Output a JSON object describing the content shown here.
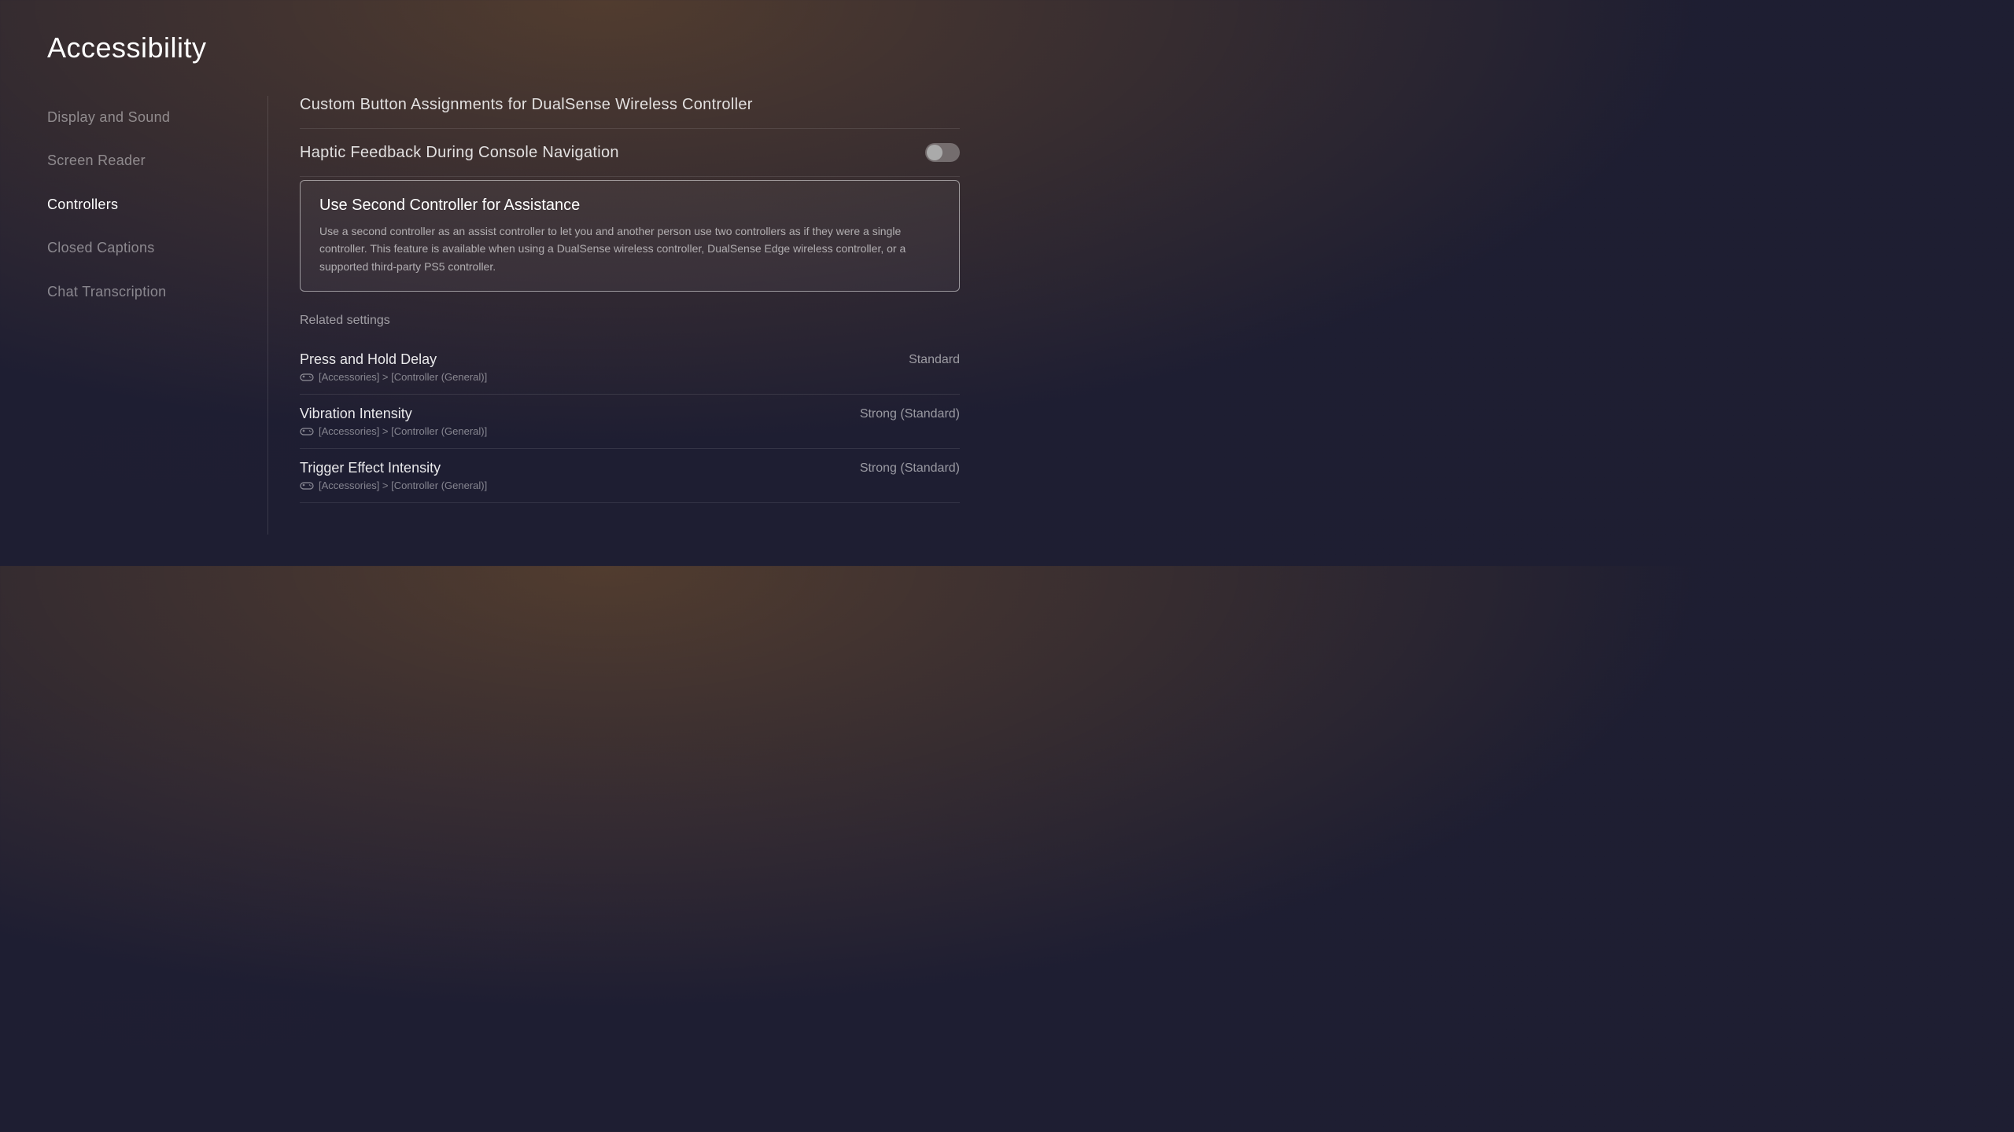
{
  "page": {
    "title": "Accessibility"
  },
  "sidebar": {
    "items": [
      {
        "id": "display-sound",
        "label": "Display and Sound",
        "active": false
      },
      {
        "id": "screen-reader",
        "label": "Screen Reader",
        "active": false
      },
      {
        "id": "controllers",
        "label": "Controllers",
        "active": true
      },
      {
        "id": "closed-captions",
        "label": "Closed Captions",
        "active": false
      },
      {
        "id": "chat-transcription",
        "label": "Chat Transcription",
        "active": false
      }
    ]
  },
  "main": {
    "items": [
      {
        "id": "custom-button-assignments",
        "title": "Custom Button Assignments for DualSense Wireless Controller",
        "hasToggle": false
      },
      {
        "id": "haptic-feedback",
        "title": "Haptic Feedback During Console Navigation",
        "hasToggle": true,
        "toggleOn": false
      }
    ],
    "selectedCard": {
      "title": "Use Second Controller for Assistance",
      "description": "Use a second controller as an assist controller to let you and another person use two controllers as if they were a single controller. This feature is available when using a DualSense wireless controller, DualSense Edge wireless controller, or a supported third-party PS5 controller."
    },
    "relatedSettings": {
      "label": "Related settings",
      "items": [
        {
          "id": "press-hold-delay",
          "title": "Press and Hold Delay",
          "path": "[Accessories] > [Controller (General)]",
          "value": "Standard"
        },
        {
          "id": "vibration-intensity",
          "title": "Vibration Intensity",
          "path": "[Accessories] > [Controller (General)]",
          "value": "Strong (Standard)"
        },
        {
          "id": "trigger-effect-intensity",
          "title": "Trigger Effect Intensity",
          "path": "[Accessories] > [Controller (General)]",
          "value": "Strong (Standard)"
        }
      ]
    }
  }
}
